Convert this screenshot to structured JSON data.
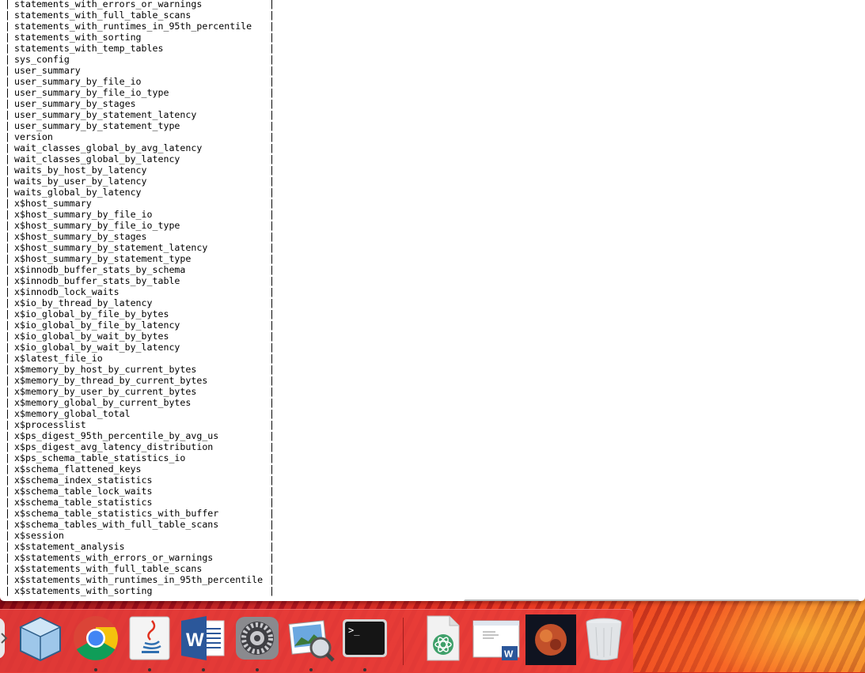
{
  "terminal": {
    "lines": [
      "statements_with_errors_or_warnings",
      "statements_with_full_table_scans",
      "statements_with_runtimes_in_95th_percentile",
      "statements_with_sorting",
      "statements_with_temp_tables",
      "sys_config",
      "user_summary",
      "user_summary_by_file_io",
      "user_summary_by_file_io_type",
      "user_summary_by_stages",
      "user_summary_by_statement_latency",
      "user_summary_by_statement_type",
      "version",
      "wait_classes_global_by_avg_latency",
      "wait_classes_global_by_latency",
      "waits_by_host_by_latency",
      "waits_by_user_by_latency",
      "waits_global_by_latency",
      "x$host_summary",
      "x$host_summary_by_file_io",
      "x$host_summary_by_file_io_type",
      "x$host_summary_by_stages",
      "x$host_summary_by_statement_latency",
      "x$host_summary_by_statement_type",
      "x$innodb_buffer_stats_by_schema",
      "x$innodb_buffer_stats_by_table",
      "x$innodb_lock_waits",
      "x$io_by_thread_by_latency",
      "x$io_global_by_file_by_bytes",
      "x$io_global_by_file_by_latency",
      "x$io_global_by_wait_by_bytes",
      "x$io_global_by_wait_by_latency",
      "x$latest_file_io",
      "x$memory_by_host_by_current_bytes",
      "x$memory_by_thread_by_current_bytes",
      "x$memory_by_user_by_current_bytes",
      "x$memory_global_by_current_bytes",
      "x$memory_global_total",
      "x$processlist",
      "x$ps_digest_95th_percentile_by_avg_us",
      "x$ps_digest_avg_latency_distribution",
      "x$ps_schema_table_statistics_io",
      "x$schema_flattened_keys",
      "x$schema_index_statistics",
      "x$schema_table_lock_waits",
      "x$schema_table_statistics",
      "x$schema_table_statistics_with_buffer",
      "x$schema_tables_with_full_table_scans",
      "x$session",
      "x$statement_analysis",
      "x$statements_with_errors_or_warnings",
      "x$statements_with_full_table_scans",
      "x$statements_with_runtimes_in_95th_percentile",
      "x$statements_with_sorting"
    ],
    "border_char": "|"
  },
  "dock": {
    "items": [
      {
        "name": "finder",
        "icon": "finder-icon",
        "running": false
      },
      {
        "name": "virtualbox",
        "icon": "virtualbox-cube-icon",
        "running": false
      },
      {
        "name": "chrome",
        "icon": "chrome-icon",
        "running": true
      },
      {
        "name": "java",
        "icon": "java-icon",
        "running": true
      },
      {
        "name": "word",
        "icon": "word-icon",
        "running": true
      },
      {
        "name": "system-preferences",
        "icon": "gear-icon",
        "running": true
      },
      {
        "name": "preview",
        "icon": "preview-icon",
        "running": true
      },
      {
        "name": "terminal",
        "icon": "terminal-icon",
        "running": true
      },
      {
        "name": "atom-document",
        "icon": "atom-doc-icon",
        "running": false
      },
      {
        "name": "word-document",
        "icon": "word-doc-icon",
        "running": false
      },
      {
        "name": "image-thumbnail",
        "icon": "image-icon",
        "running": false
      },
      {
        "name": "trash",
        "icon": "trash-icon",
        "running": false
      }
    ],
    "terminal_prompt": ">_"
  },
  "colors": {
    "dock_bg": "#e83e3a",
    "terminal_bg": "#ffffff",
    "word_blue": "#2b579a",
    "chrome_red": "#db4437",
    "chrome_yellow": "#f4c20d",
    "chrome_green": "#0f9d58",
    "chrome_blue": "#4285f4"
  }
}
